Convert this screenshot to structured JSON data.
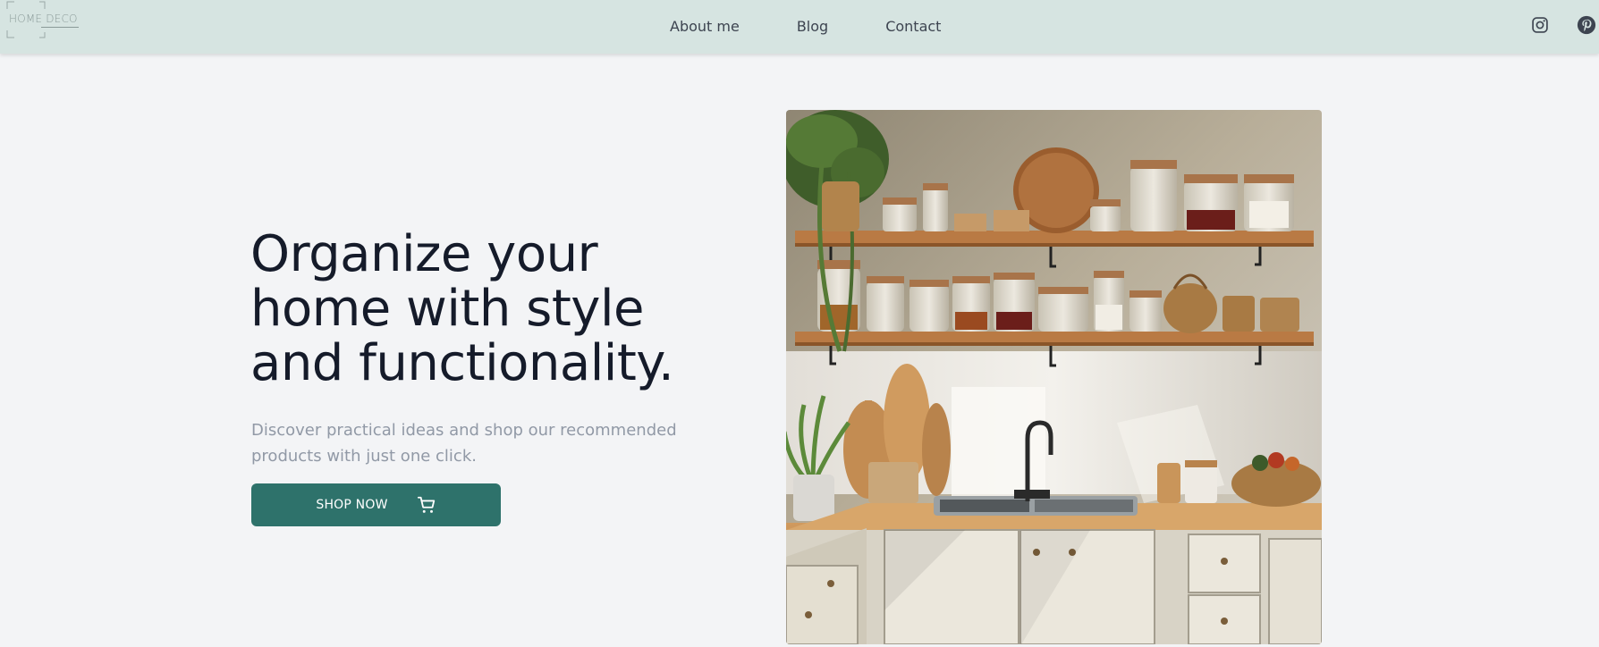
{
  "header": {
    "logo_text": "HOME DECO",
    "nav": [
      "About me",
      "Blog",
      "Contact"
    ],
    "social": [
      "instagram-icon",
      "pinterest-icon"
    ]
  },
  "hero": {
    "title": "Organize your home with style and functionality.",
    "subtitle": "Discover practical ideas and shop our recommended products with just one click.",
    "cta_label": "SHOP NOW",
    "cta_icon": "shopping-cart-icon"
  },
  "colors": {
    "header_bg": "#d6e4e1",
    "page_bg": "#f3f4f6",
    "accent": "#2e726b",
    "title": "#151b2a",
    "subtitle": "#9199a6"
  }
}
